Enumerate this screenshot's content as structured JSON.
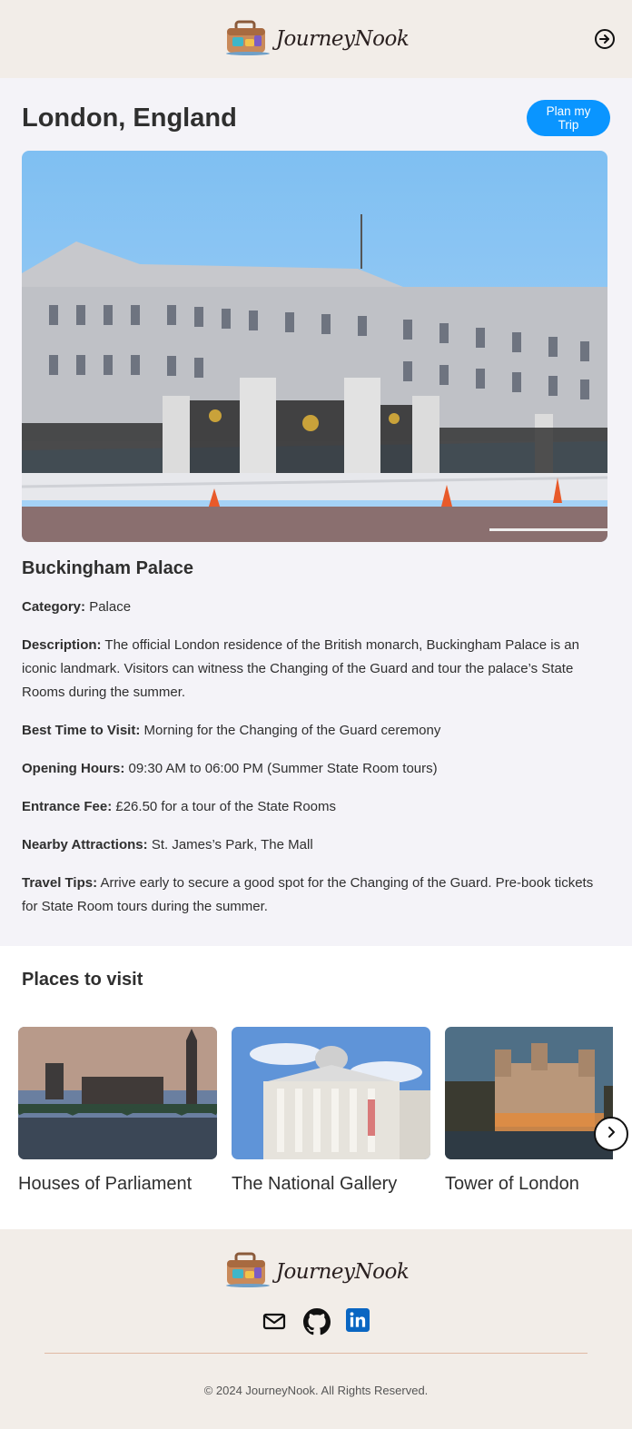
{
  "header": {
    "brand": "JourneyNook",
    "logo_icon": "suitcase-icon",
    "logout_icon": "logout-icon"
  },
  "detail": {
    "location": "London, England",
    "plan_button": "Plan my Trip",
    "place_name": "Buckingham Palace",
    "fields": [
      {
        "label": "Category:",
        "value": "Palace"
      },
      {
        "label": "Description:",
        "value": "The official London residence of the British monarch, Buckingham Palace is an iconic landmark. Visitors can witness the Changing of the Guard and tour the palace’s State Rooms during the summer."
      },
      {
        "label": "Best Time to Visit:",
        "value": "Morning for the Changing of the Guard ceremony"
      },
      {
        "label": "Opening Hours:",
        "value": "09:30 AM to 06:00 PM (Summer State Room tours)"
      },
      {
        "label": "Entrance Fee:",
        "value": "£26.50 for a tour of the State Rooms"
      },
      {
        "label": "Nearby Attractions:",
        "value": "St. James’s Park, The Mall"
      },
      {
        "label": "Travel Tips:",
        "value": "Arrive early to secure a good spot for the Changing of the Guard. Pre-book tickets for State Room tours during the summer."
      }
    ]
  },
  "places": {
    "heading": "Places to visit",
    "items": [
      {
        "name": "Houses of Parliament"
      },
      {
        "name": "The National Gallery"
      },
      {
        "name": "Tower of London"
      }
    ],
    "next_icon": "chevron-right-icon"
  },
  "footer": {
    "brand": "JourneyNook",
    "social_icons": [
      "mail-icon",
      "github-icon",
      "linkedin-icon"
    ],
    "copyright": "© 2024 JourneyNook. All Rights Reserved."
  },
  "colors": {
    "accent": "#0a95ff",
    "header_bg": "#f2ede8",
    "page_bg": "#f4f3f8",
    "linkedin": "#0a66c2"
  }
}
